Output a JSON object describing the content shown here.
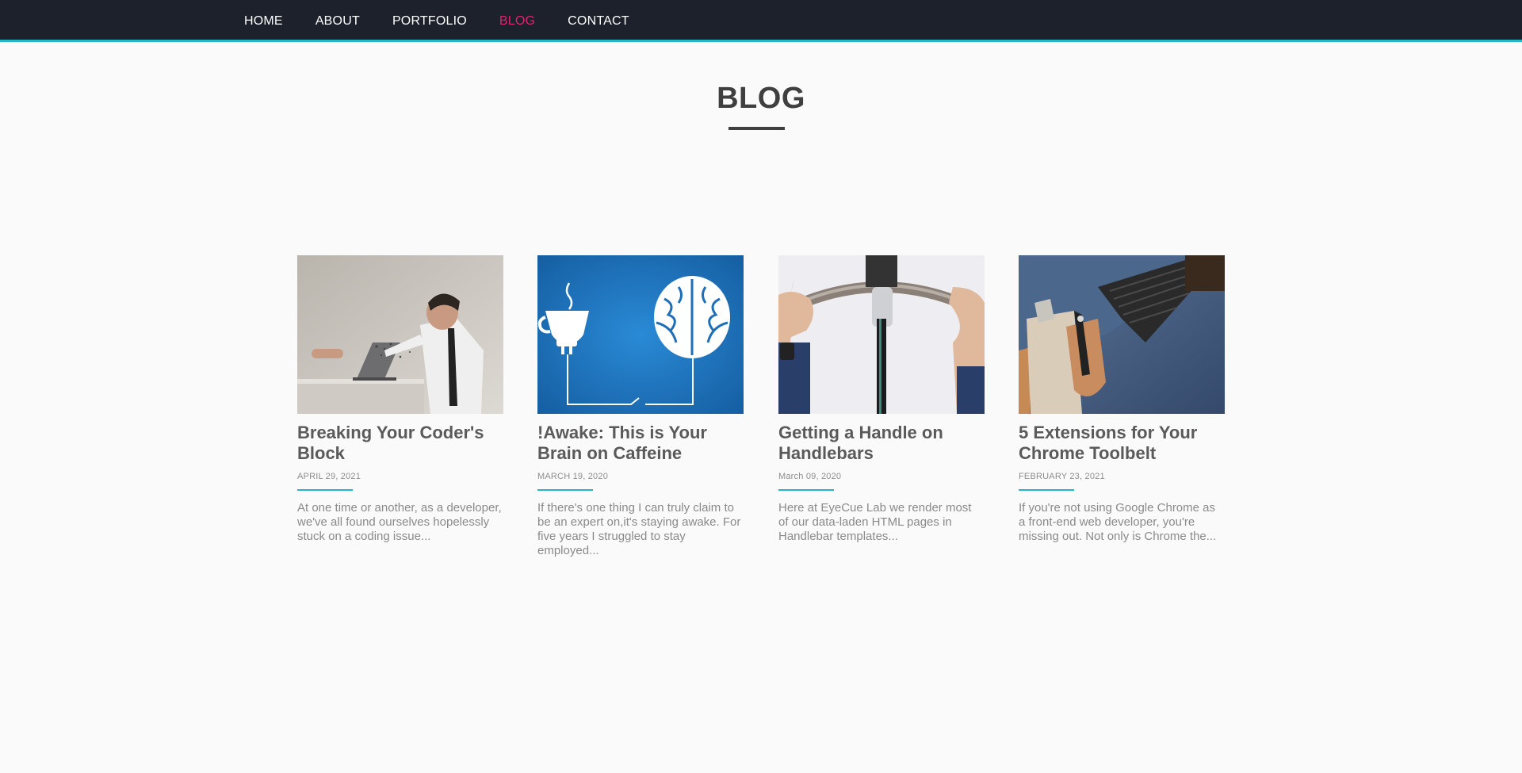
{
  "nav": {
    "items": [
      {
        "label": "HOME",
        "active": false
      },
      {
        "label": "ABOUT",
        "active": false
      },
      {
        "label": "PORTFOLIO",
        "active": false
      },
      {
        "label": "BLOG",
        "active": true
      },
      {
        "label": "CONTACT",
        "active": false
      }
    ],
    "accent_color": "#e0236e",
    "underline_color": "#23b8c8",
    "background": "#1c212c"
  },
  "page": {
    "title": "BLOG"
  },
  "posts": [
    {
      "title": "Breaking Your Coder's Block",
      "date": "APRIL 29, 2021",
      "excerpt": "At one time or another, as a developer, we've all found ourselves hopelessly stuck on a coding issue...",
      "image": "frustrated-man-punching-laptop"
    },
    {
      "title": "!Awake: This is Your Brain on Caffeine",
      "date": "MARCH 19, 2020",
      "excerpt": "If there's one thing I can truly claim to be an expert on,it's staying awake. For five years I struggled to stay employed...",
      "image": "coffee-cup-plug-brain-circuit"
    },
    {
      "title": "Getting a Handle on Handlebars",
      "date": "March 09, 2020",
      "excerpt": "Here at EyeCue Lab we render most of our data-laden HTML pages in Handlebar templates...",
      "image": "hands-on-bicycle-handlebars"
    },
    {
      "title": "5 Extensions for Your Chrome Toolbelt",
      "date": "FEBRUARY 23, 2021",
      "excerpt": "If you're not using Google Chrome as a front-end web developer, you're missing out. Not only is Chrome the...",
      "image": "jeans-with-tool-belt"
    }
  ]
}
